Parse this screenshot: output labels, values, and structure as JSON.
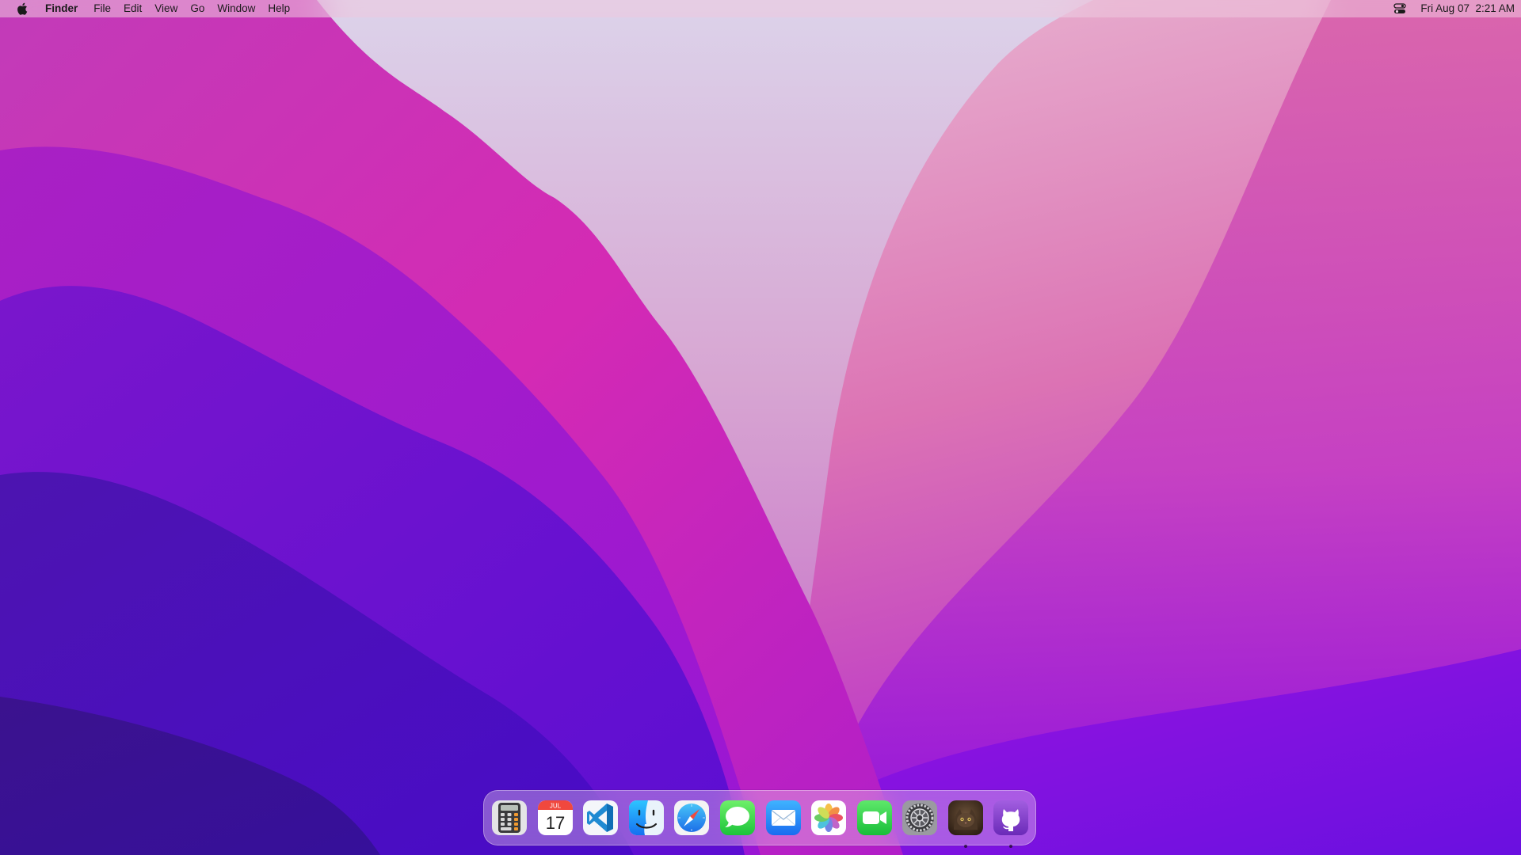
{
  "menubar": {
    "apple_icon": "apple-logo-icon",
    "app_name": "Finder",
    "menus": [
      "File",
      "Edit",
      "View",
      "Go",
      "Window",
      "Help"
    ],
    "control_center_icon": "control-center-icon",
    "clock": "Fri Aug 07  2:21 AM"
  },
  "dock": {
    "apps": [
      {
        "name": "Calculator",
        "icon": "calculator-icon",
        "running": false
      },
      {
        "name": "Calendar",
        "icon": "calendar-icon",
        "running": false,
        "month": "JUL",
        "day": "17"
      },
      {
        "name": "Visual Studio Code",
        "icon": "vscode-icon",
        "running": false
      },
      {
        "name": "Finder",
        "icon": "finder-icon",
        "running": false
      },
      {
        "name": "Safari",
        "icon": "safari-icon",
        "running": false
      },
      {
        "name": "Messages",
        "icon": "messages-icon",
        "running": false
      },
      {
        "name": "Mail",
        "icon": "mail-icon",
        "running": false
      },
      {
        "name": "Photos",
        "icon": "photos-icon",
        "running": false
      },
      {
        "name": "FaceTime",
        "icon": "facetime-icon",
        "running": false
      },
      {
        "name": "System Preferences",
        "icon": "system-preferences-icon",
        "running": false
      },
      {
        "name": "Cat App",
        "icon": "cat-photo-icon",
        "running": true
      },
      {
        "name": "GitHub Desktop",
        "icon": "github-icon",
        "running": true
      }
    ]
  },
  "colors": {
    "wallpaper_deep": "#3a1496",
    "wallpaper_violet": "#6a0fd0",
    "wallpaper_magenta": "#d02fb0",
    "wallpaper_pink": "#e070b0",
    "wallpaper_haze": "#d8c8e6"
  }
}
